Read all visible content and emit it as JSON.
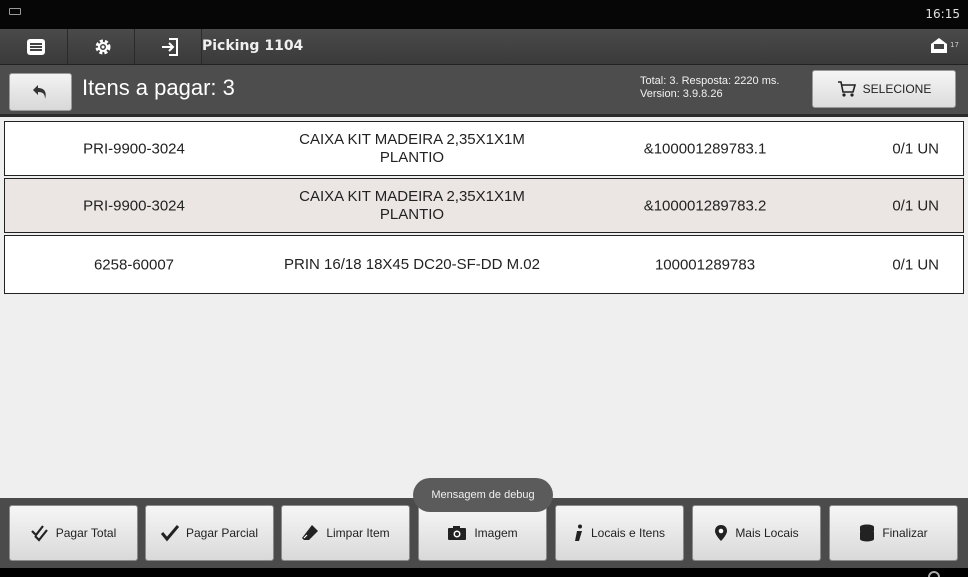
{
  "statusbar": {
    "time": "16:15"
  },
  "actionbar": {
    "title": "Picking 1104",
    "message_count": "17",
    "icons": [
      "list-icon",
      "gear-icon",
      "login-icon",
      "message-icon"
    ]
  },
  "header": {
    "title": "Itens a pagar: 3",
    "info_line1": "Total: 3. Resposta: 2220 ms.",
    "info_line2": "Version: 3.9.8.26",
    "select_label": "SELECIONE"
  },
  "rows": [
    {
      "code": "PRI-9900-3024",
      "desc_line1": "CAIXA KIT MADEIRA 2,35X1X1M",
      "desc_line2": "PLANTIO",
      "ref": "&100001289783.1",
      "qty": "0/1 UN"
    },
    {
      "code": "PRI-9900-3024",
      "desc_line1": "CAIXA KIT MADEIRA 2,35X1X1M",
      "desc_line2": "PLANTIO",
      "ref": "&100001289783.2",
      "qty": "0/1 UN"
    },
    {
      "code": "6258-60007",
      "desc_line1": "PRIN 16/18 18X45 DC20-SF-DD M.02",
      "desc_line2": "",
      "ref": "100001289783",
      "qty": "0/1 UN"
    }
  ],
  "toast": "Mensagem de debug",
  "toolbar": {
    "pagar_total": "Pagar Total",
    "pagar_parcial": "Pagar Parcial",
    "limpar_item": "Limpar Item",
    "imagem": "Imagem",
    "locais_itens": "Locais e Itens",
    "mais_locais": "Mais Locais",
    "finalizar": "Finalizar"
  },
  "colors": {
    "bar": "#4b4b4b",
    "row_alt": "#ebe6e3",
    "toast": "#5b5b5b"
  }
}
